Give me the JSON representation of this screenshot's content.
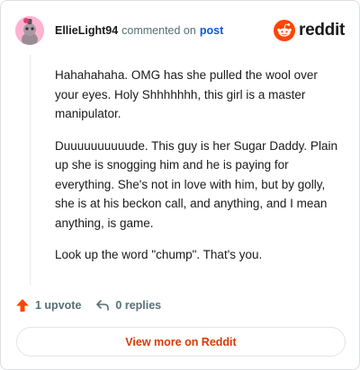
{
  "comment": {
    "author": "EllieLight94",
    "action_text": "commented on",
    "post_link_text": "post",
    "paragraphs": [
      "Hahahahaha. OMG has she pulled the wool over your eyes. Holy Shhhhhhh, this girl is a master manipulator.",
      "Duuuuuuuuuude. This guy is her Sugar Daddy. Plain up she is snogging him and he is paying for everything. She's not in love with him, but by golly, she is at his beckon call, and anything, and I mean anything, is game.",
      "Look up the word \"chump\". That's you."
    ]
  },
  "brand": {
    "name": "reddit",
    "icon": "reddit-logo-icon",
    "color": "#ff4500"
  },
  "actions": {
    "upvote_label": "1 upvote",
    "replies_label": "0 replies",
    "upvote_color": "#ff4500"
  },
  "footer": {
    "view_more_label": "View more on Reddit",
    "link_color": "#d93a00"
  }
}
